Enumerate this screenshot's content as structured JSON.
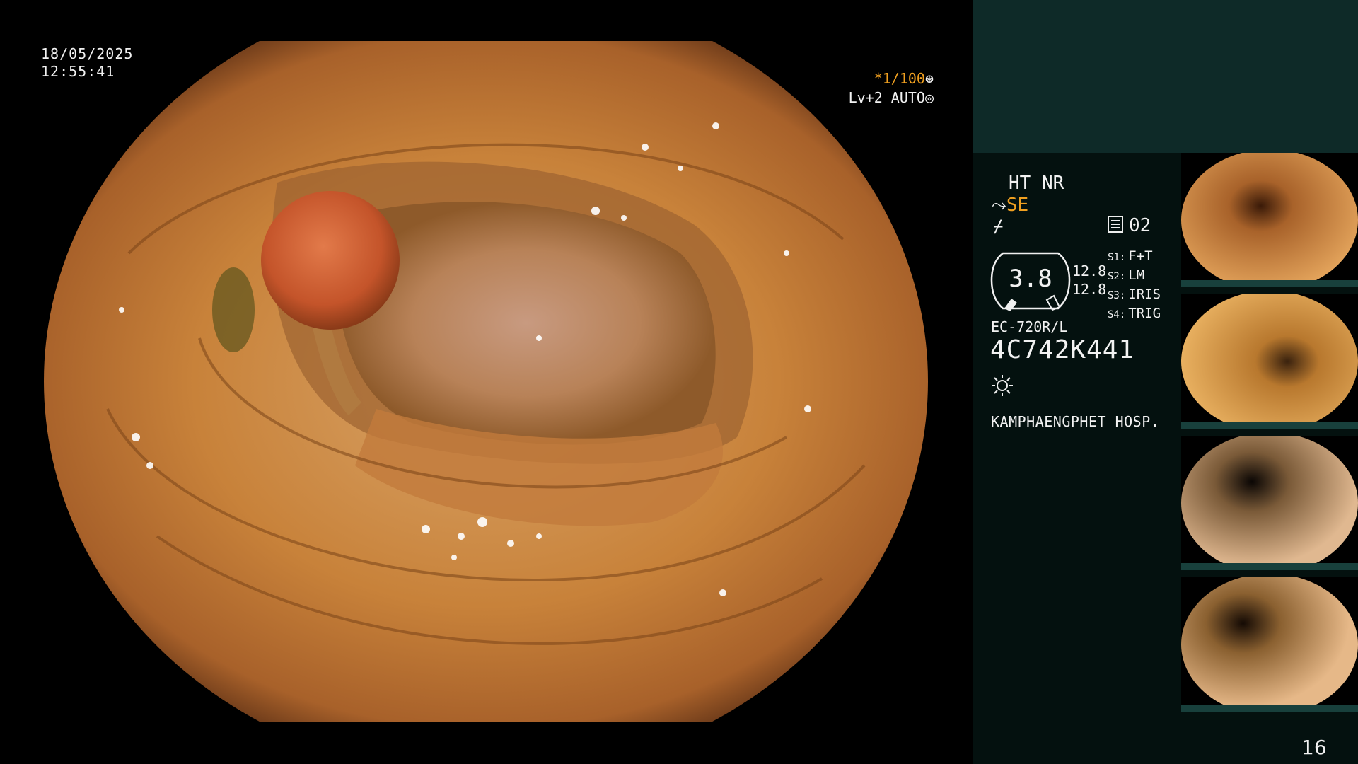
{
  "overlay": {
    "date": "18/05/2025",
    "time": "12:55:41",
    "shutter_prefix": "*",
    "shutter": "1/100",
    "level": "Lv+2 AUTO"
  },
  "status": {
    "ht": "HT NR",
    "se": "SE",
    "count": "02",
    "zoom": "3.8",
    "side_values": [
      "12.8",
      "12.8"
    ],
    "switches": [
      {
        "key": "S1:",
        "value": "F+T"
      },
      {
        "key": "S2:",
        "value": "LM"
      },
      {
        "key": "S3:",
        "value": "IRIS"
      },
      {
        "key": "S4:",
        "value": "TRIG"
      }
    ],
    "scope_model": "EC-720R/L",
    "serial": "4C742K441",
    "hospital": "KAMPHAENGPHET HOSP."
  },
  "icons": {
    "shutter": "aperture-icon",
    "level": "auto-iris-icon",
    "se": "scope-tip-icon",
    "filter": "filter-icon",
    "count": "image-count-icon",
    "light": "light-source-icon"
  },
  "page_number": "16",
  "thumbnail_count": 4
}
